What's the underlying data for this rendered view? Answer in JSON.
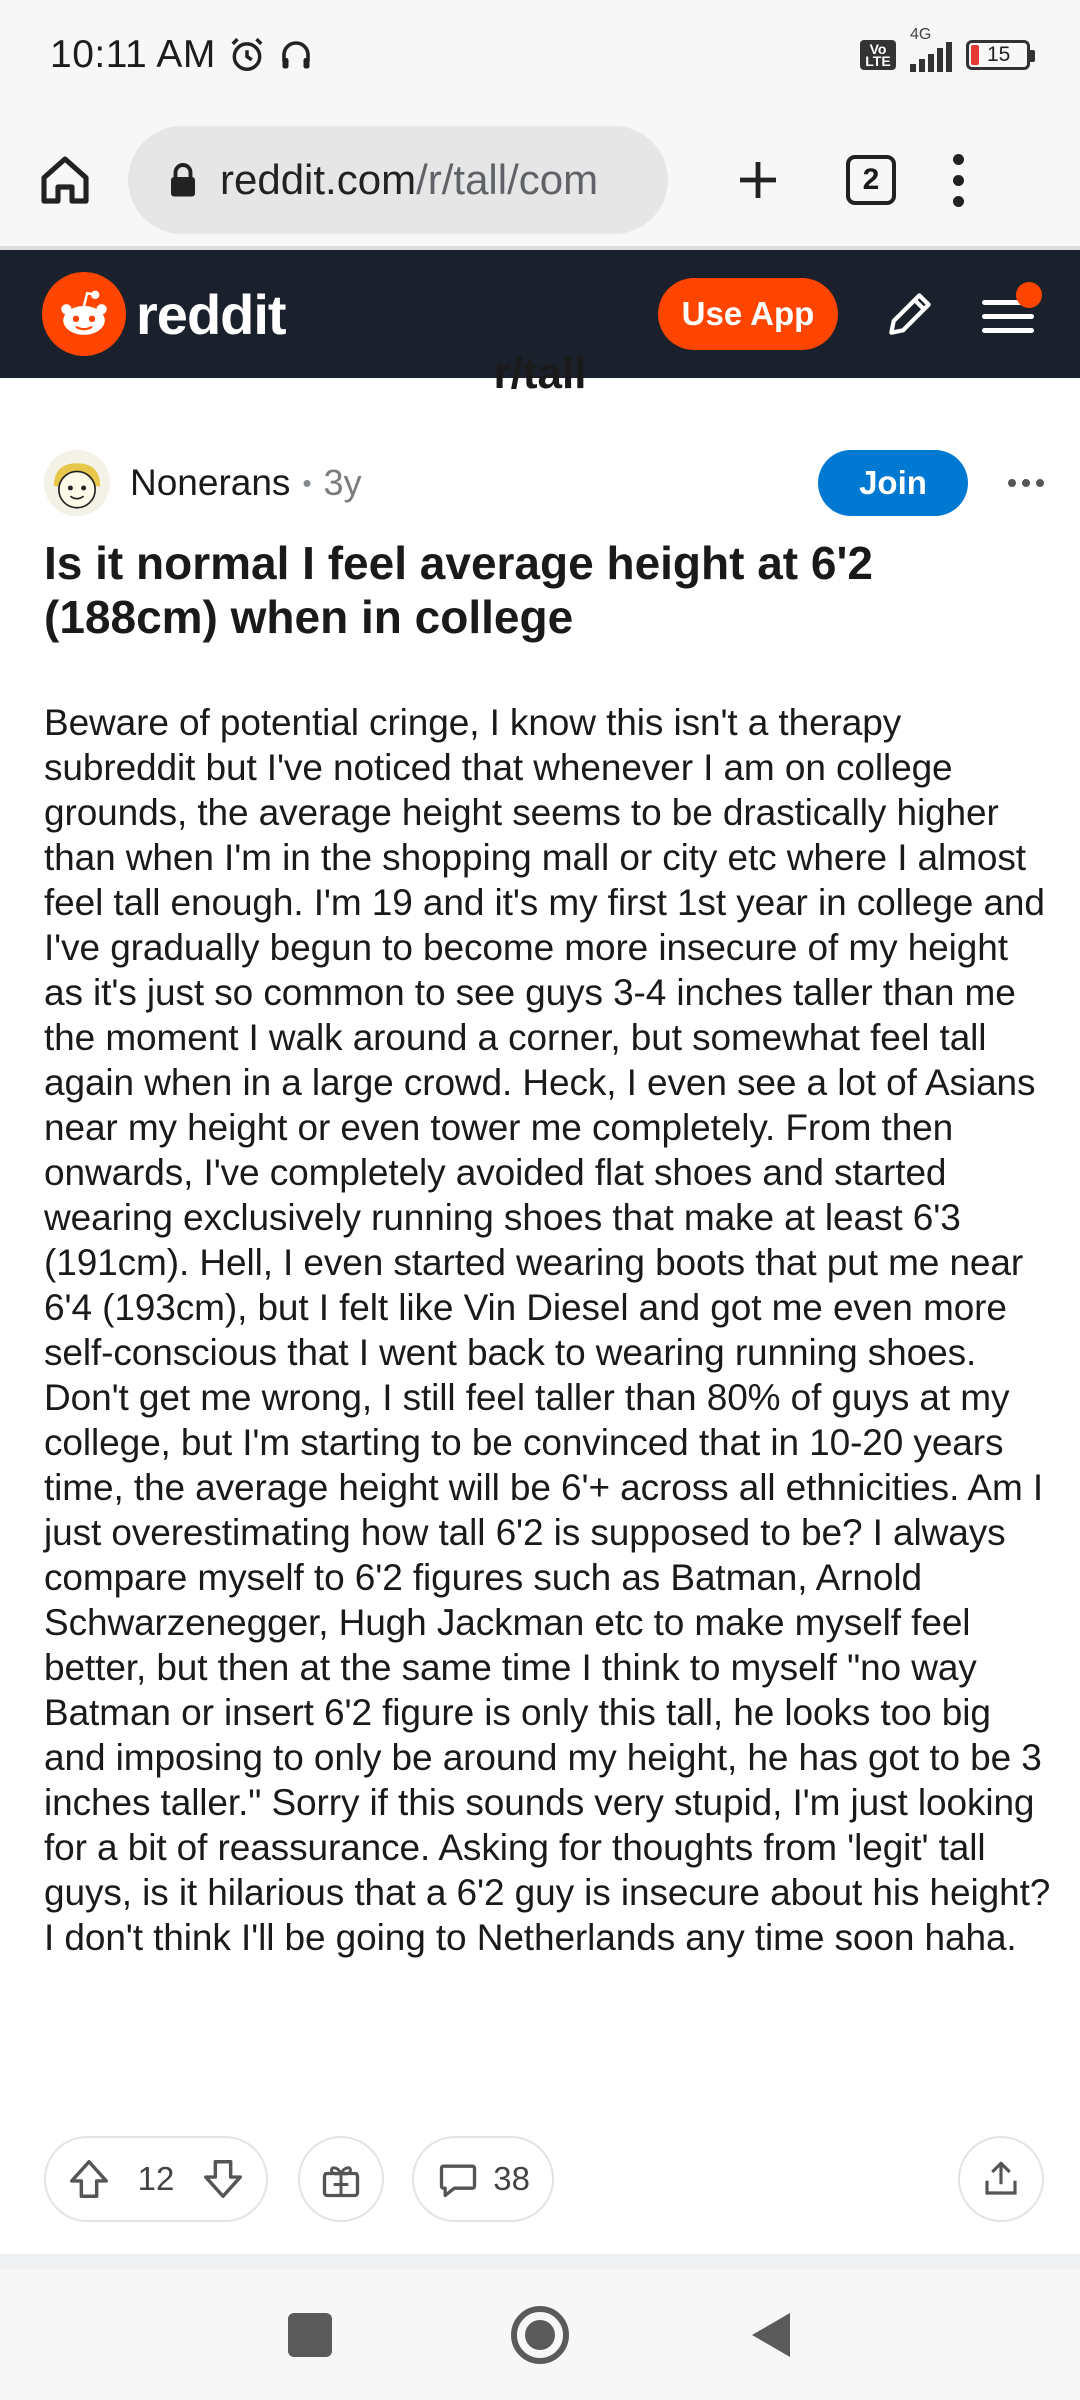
{
  "status_bar": {
    "time": "10:11 AM",
    "network": "4G",
    "volte": "Vo LTE",
    "battery": "15"
  },
  "browser": {
    "url_host": "reddit.com",
    "url_path": "/r/tall/com",
    "tab_count": "2"
  },
  "header": {
    "logo_text": "reddit",
    "use_app_label": "Use App",
    "brand_color": "#ff4500"
  },
  "subreddit": {
    "name": "r/tall"
  },
  "post": {
    "author": "Nonerans",
    "age": "3y",
    "join_label": "Join",
    "title": "Is it normal I feel average height at 6'2 (188cm) when in college",
    "body": "Beware of potential cringe, I know this isn't a therapy subreddit but I've noticed that whenever I am on college grounds, the average height seems to be drastically higher than when I'm in the shopping mall or city etc where I almost feel tall enough. I'm 19 and it's my first 1st year in college and I've gradually begun to become more insecure of my height as it's just so common to see guys 3-4 inches taller than me the moment I walk around a corner, but somewhat feel tall again when in a large crowd. Heck, I even see a lot of Asians near my height or even tower me completely. From then onwards, I've completely avoided flat shoes and started wearing exclusively running shoes that make at least 6'3 (191cm). Hell, I even started wearing boots that put me near 6'4 (193cm), but I felt like Vin Diesel and got me even more self-conscious that I went back to wearing running shoes. Don't get me wrong, I still feel taller than 80% of guys at my college, but I'm starting to be convinced that in 10-20 years time, the average height will be 6'+ across all ethnicities. Am I just overestimating how tall 6'2 is supposed to be? I always compare myself to 6'2 figures such as Batman, Arnold Schwarzenegger, Hugh Jackman etc to make myself feel better, but then at the same time I think to myself \"no way Batman or insert 6'2 figure is only this tall, he looks too big and imposing to only be around my height, he has got to be 3 inches taller.\" Sorry if this sounds very stupid, I'm just looking for a bit of reassurance. Asking for thoughts from 'legit' tall guys, is it hilarious that a 6'2 guy is insecure about his height? I don't think I'll be going to Netherlands any time soon haha.",
    "votes": "12",
    "comments": "38"
  }
}
